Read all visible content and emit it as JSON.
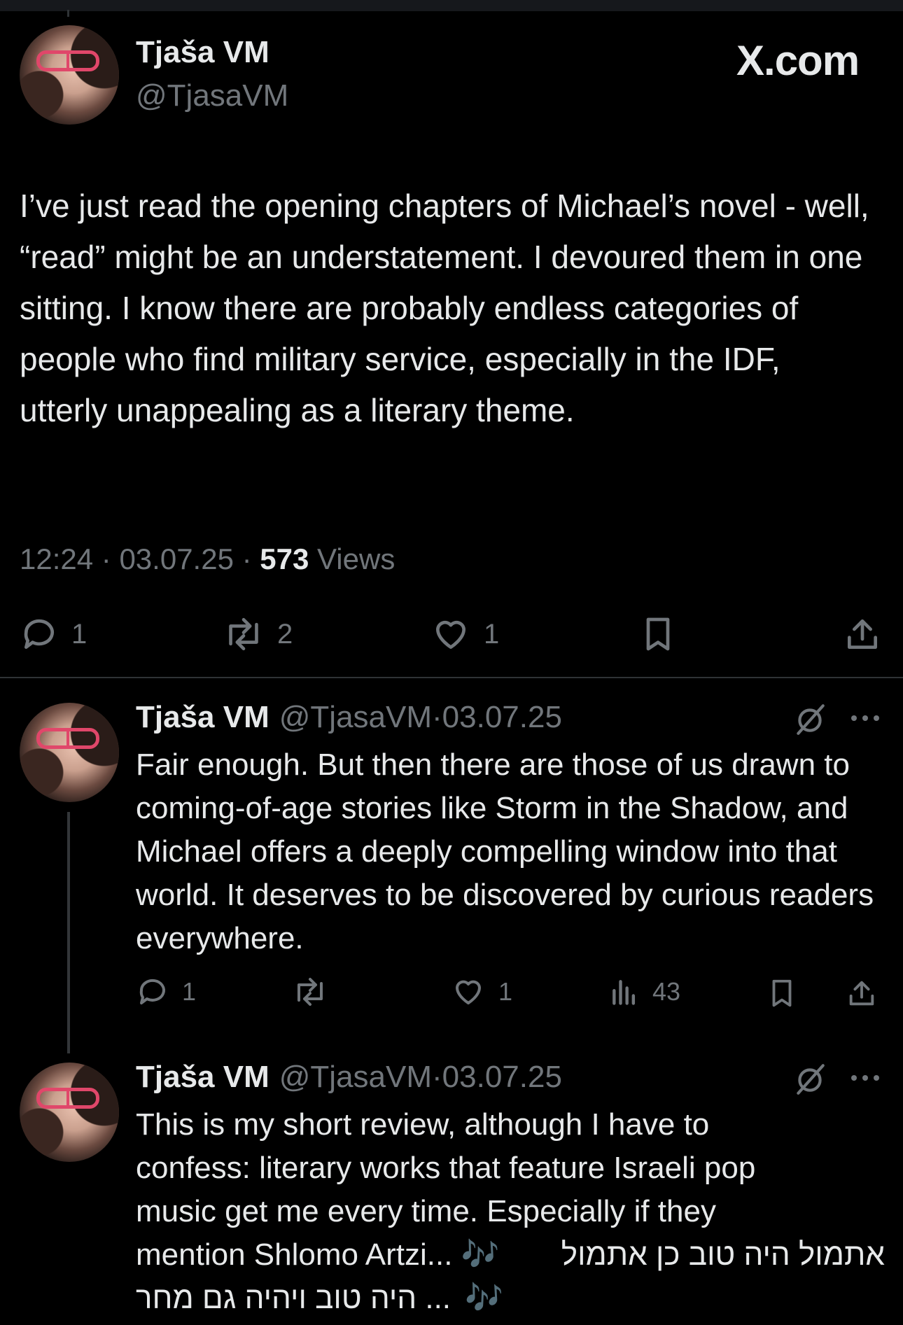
{
  "main_tweet": {
    "author_name": "Tjaša VM",
    "author_handle": "@TjasaVM",
    "brand": "X.com",
    "text": "I’ve just read the opening chapters of Michael’s novel - well, “read” might be an understatement. I devoured them in one sitting. I know there are probably endless categories of people who find military service, especially in the IDF, utterly unappealing as a literary theme.",
    "time": "12:24",
    "date": "03.07.25",
    "separator": "·",
    "views_count": "573",
    "views_label": "Views",
    "actions": {
      "replies": "1",
      "reposts": "2",
      "likes": "1"
    }
  },
  "replies": [
    {
      "author_name": "Tjaša VM",
      "author_handle": "@TjasaVM",
      "date": "03.07.25",
      "separator": "·",
      "text": "Fair enough. But then there are those of us drawn to coming-of-age stories like Storm in the Shadow, and Michael offers a deeply compelling window into that world. It deserves to be discovered by curious readers everywhere.",
      "actions": {
        "replies": "1",
        "reposts": "",
        "likes": "1",
        "views": "43"
      }
    },
    {
      "author_name": "Tjaša VM",
      "author_handle": "@TjasaVM",
      "date": "03.07.25",
      "separator": "·",
      "text_line1": "This is my short review, although I have to",
      "text_line2": "confess: literary works that feature Israeli pop",
      "text_line3": "music get me every time. Especially if they",
      "text_line4_a": "mention Shlomo Artzi... 🎶",
      "text_line4_b": "אתמול היה טוב כן אתמול",
      "text_line5_a": "🎶",
      "text_line5_b": "... היה טוב ויהיה גם מחר"
    }
  ],
  "colors": {
    "background": "#000000",
    "text": "#e7e9ea",
    "secondary": "#71767b",
    "divider": "#2f3336",
    "glasses": "#e0476a"
  },
  "icons": [
    "reply-icon",
    "repost-icon",
    "like-icon",
    "bookmark-icon",
    "share-icon",
    "views-icon",
    "grok-slash-icon",
    "more-icon"
  ]
}
